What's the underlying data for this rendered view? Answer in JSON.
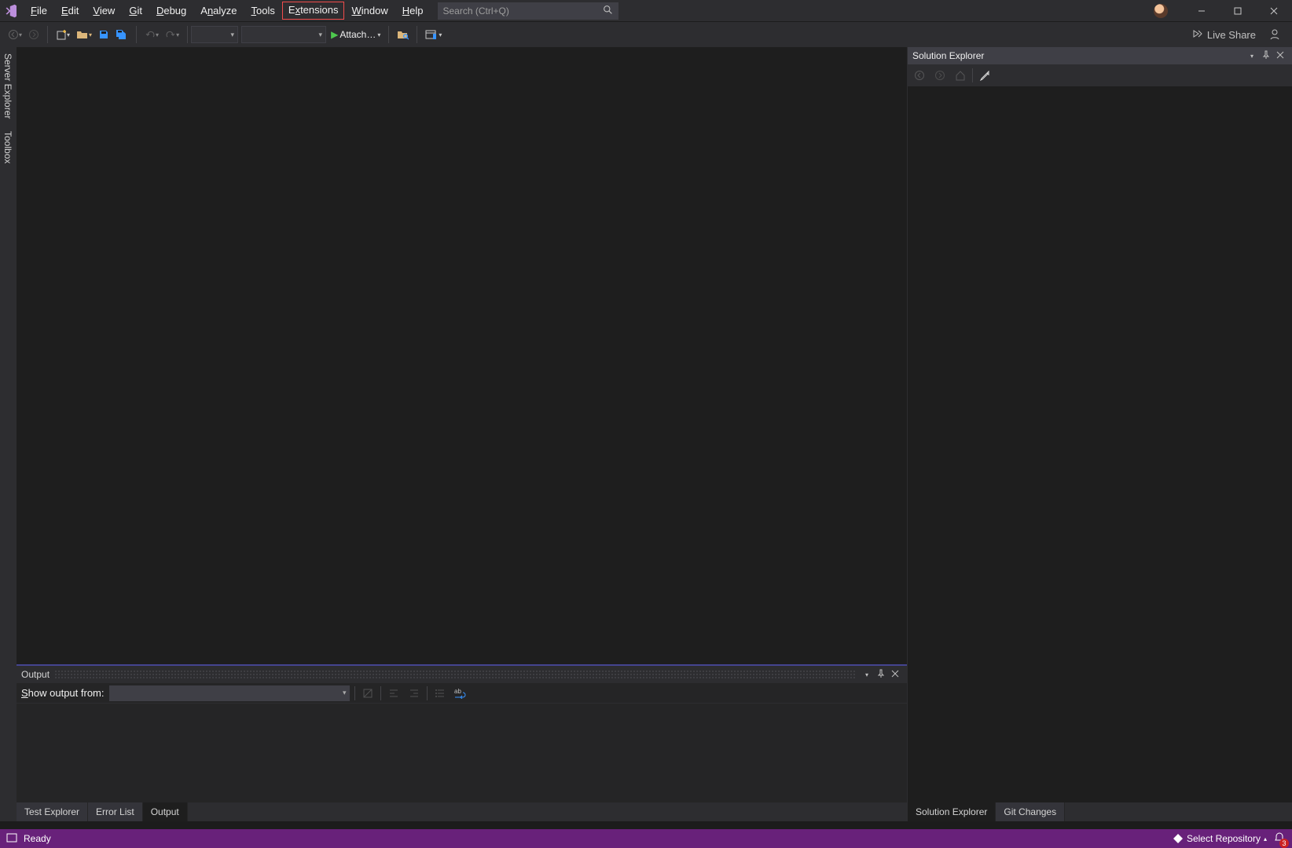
{
  "menu": {
    "items": [
      "File",
      "Edit",
      "View",
      "Git",
      "Debug",
      "Analyze",
      "Tools",
      "Extensions",
      "Window",
      "Help"
    ],
    "highlighted_index": 7
  },
  "search": {
    "placeholder": "Search (Ctrl+Q)"
  },
  "toolbar": {
    "attach_label": "Attach…",
    "live_share_label": "Live Share"
  },
  "side_tabs": [
    "Server Explorer",
    "Toolbox"
  ],
  "output_panel": {
    "title": "Output",
    "source_label": "Show output from:",
    "source_value": ""
  },
  "bottom_tabs": {
    "left": [
      "Test Explorer",
      "Error List",
      "Output"
    ],
    "left_active": 2,
    "right": [
      "Solution Explorer",
      "Git Changes"
    ],
    "right_active": 0
  },
  "solution_explorer": {
    "title": "Solution Explorer"
  },
  "statusbar": {
    "ready": "Ready",
    "repo_label": "Select Repository",
    "notif_count": "3"
  }
}
